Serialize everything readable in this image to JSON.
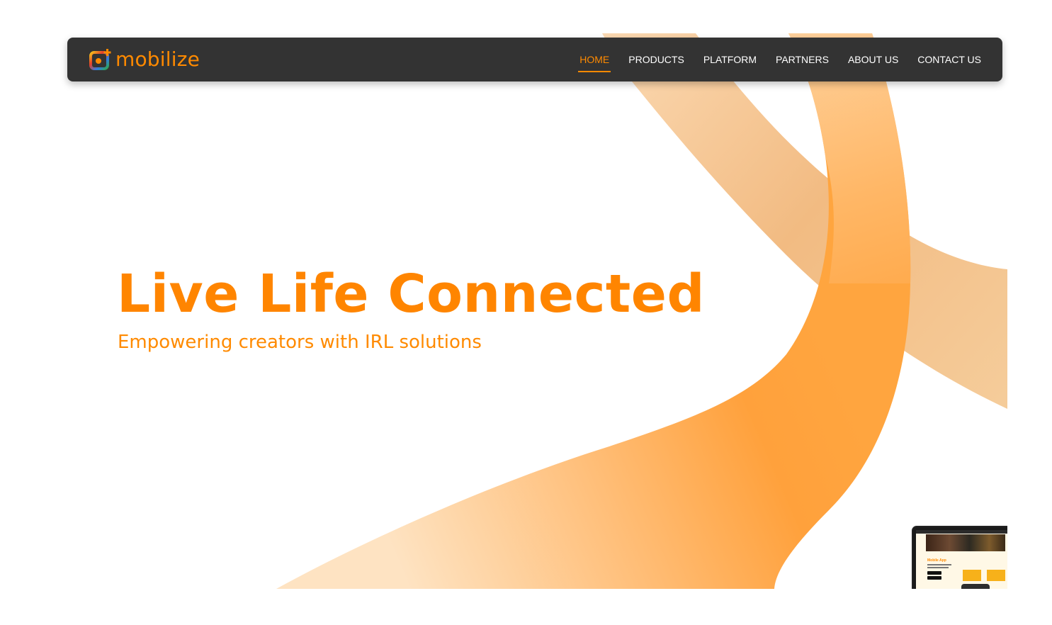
{
  "brand": {
    "name": "mobilize",
    "accent": "#ff8a00",
    "logo_icon": "camera-plus-icon"
  },
  "nav": {
    "items": [
      {
        "label": "HOME",
        "active": true
      },
      {
        "label": "PRODUCTS",
        "active": false
      },
      {
        "label": "PLATFORM",
        "active": false
      },
      {
        "label": "PARTNERS",
        "active": false
      },
      {
        "label": "ABOUT US",
        "active": false
      },
      {
        "label": "CONTACT US",
        "active": false
      }
    ]
  },
  "hero": {
    "headline": "Live Life Connected",
    "subheadline": "Empowering creators with IRL solutions"
  },
  "device_preview": {
    "screen_title": "Mobile App"
  },
  "colors": {
    "navbar": "#333333",
    "headline": "#ff8500",
    "ribbon_light": "#fde0be",
    "ribbon_dark": "#ffa03a"
  }
}
